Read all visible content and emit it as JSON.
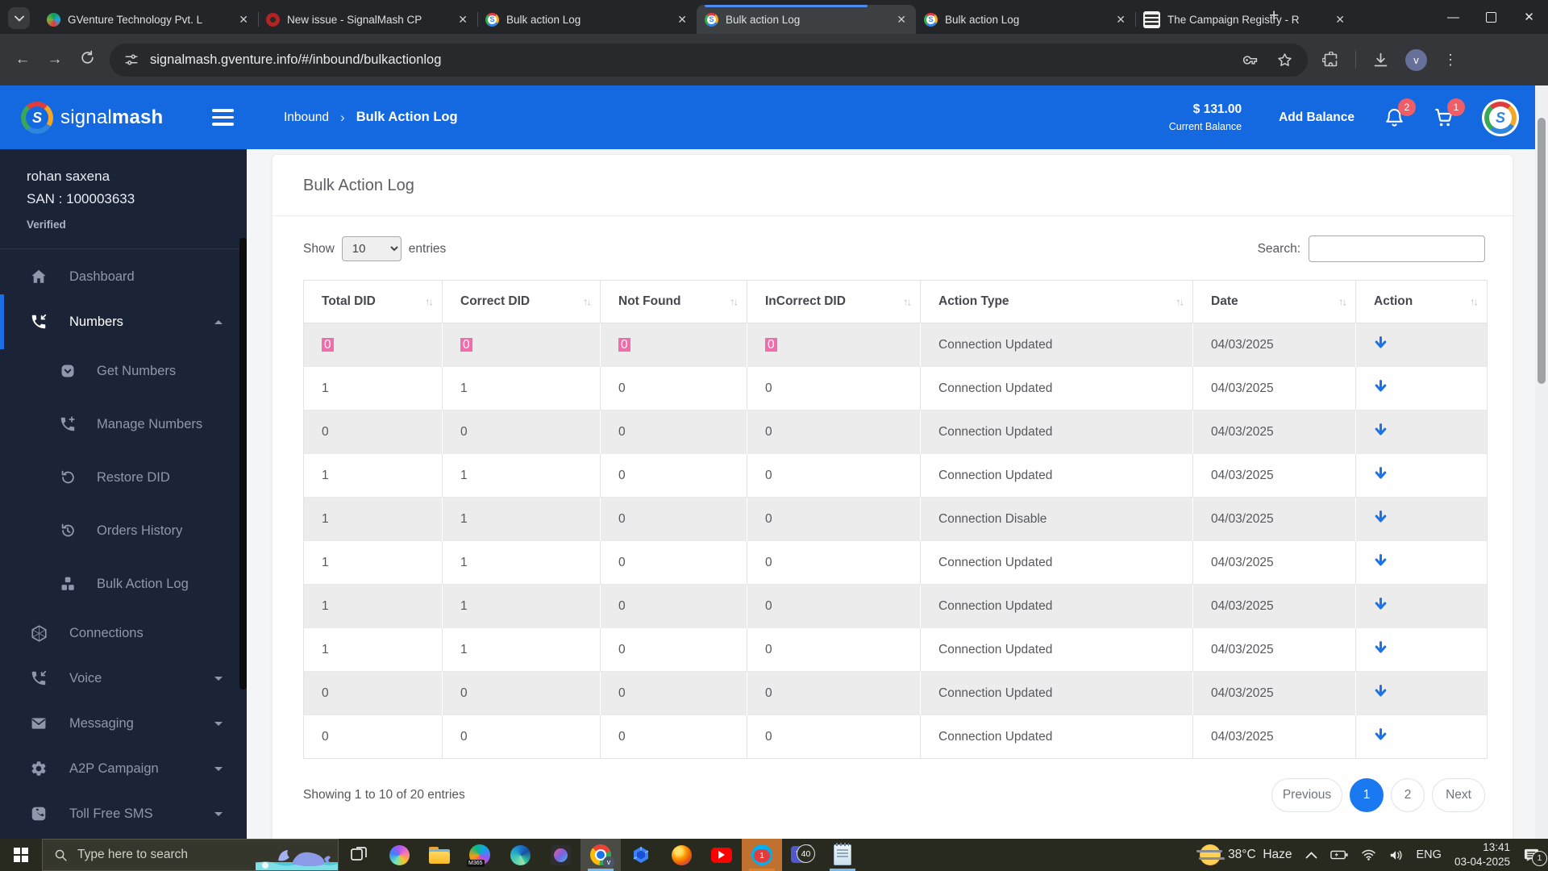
{
  "browser": {
    "tabs": [
      {
        "title": "GVenture Technology Pvt. L",
        "favicon": "gventure",
        "active": false
      },
      {
        "title": "New issue - SignalMash CP",
        "favicon": "redmine",
        "active": false
      },
      {
        "title": "Bulk action Log",
        "favicon": "signalmash",
        "active": false
      },
      {
        "title": "Bulk action Log",
        "favicon": "signalmash",
        "active": true
      },
      {
        "title": "Bulk action Log",
        "favicon": "signalmash",
        "active": false
      },
      {
        "title": "The Campaign Registry - R",
        "favicon": "tcr",
        "active": false
      }
    ],
    "url": "signalmash.gventure.info/#/inbound/bulkactionlog",
    "profile_initial": "v"
  },
  "header": {
    "brand_light": "signal",
    "brand_bold": "mash",
    "breadcrumb_parent": "Inbound",
    "breadcrumb_current": "Bulk Action Log",
    "balance_amount": "$ 131.00",
    "balance_label": "Current Balance",
    "add_balance_label": "Add Balance",
    "bell_badge": "2",
    "cart_badge": "1"
  },
  "sidebar": {
    "user_name": "rohan saxena",
    "user_san": "SAN : 100003633",
    "user_status": "Verified",
    "items": [
      {
        "label": "Dashboard",
        "icon": "home",
        "sub": false,
        "active": false,
        "caret": ""
      },
      {
        "label": "Numbers",
        "icon": "phone-incoming",
        "sub": false,
        "active": true,
        "caret": "up"
      },
      {
        "label": "Get Numbers",
        "icon": "chevron-circle",
        "sub": true,
        "active": false,
        "caret": ""
      },
      {
        "label": "Manage Numbers",
        "icon": "phone-plus",
        "sub": true,
        "active": false,
        "caret": ""
      },
      {
        "label": "Restore DID",
        "icon": "restore",
        "sub": true,
        "active": false,
        "caret": ""
      },
      {
        "label": "Orders History",
        "icon": "history",
        "sub": true,
        "active": false,
        "caret": ""
      },
      {
        "label": "Bulk Action Log",
        "icon": "cubes",
        "sub": true,
        "active": false,
        "caret": ""
      },
      {
        "label": "Connections",
        "icon": "hexagon",
        "sub": false,
        "active": false,
        "caret": ""
      },
      {
        "label": "Voice",
        "icon": "phone-incoming",
        "sub": false,
        "active": false,
        "caret": "down"
      },
      {
        "label": "Messaging",
        "icon": "envelope",
        "sub": false,
        "active": false,
        "caret": "down"
      },
      {
        "label": "A2P Campaign",
        "icon": "gear",
        "sub": false,
        "active": false,
        "caret": "down"
      },
      {
        "label": "Toll Free SMS",
        "icon": "phone-square",
        "sub": false,
        "active": false,
        "caret": "down"
      }
    ]
  },
  "main": {
    "title": "Bulk Action Log",
    "show_label": "Show",
    "page_size": "10",
    "entries_label": "entries",
    "search_label": "Search:",
    "table": {
      "columns": [
        "Total DID",
        "Correct DID",
        "Not Found",
        "InCorrect DID",
        "Action Type",
        "Date",
        "Action"
      ],
      "rows": [
        {
          "total": "0",
          "correct": "0",
          "not_found": "0",
          "incorrect": "0",
          "action_type": "Connection Updated",
          "date": "04/03/2025",
          "highlighted": true
        },
        {
          "total": "1",
          "correct": "1",
          "not_found": "0",
          "incorrect": "0",
          "action_type": "Connection Updated",
          "date": "04/03/2025",
          "highlighted": false
        },
        {
          "total": "0",
          "correct": "0",
          "not_found": "0",
          "incorrect": "0",
          "action_type": "Connection Updated",
          "date": "04/03/2025",
          "highlighted": false
        },
        {
          "total": "1",
          "correct": "1",
          "not_found": "0",
          "incorrect": "0",
          "action_type": "Connection Updated",
          "date": "04/03/2025",
          "highlighted": false
        },
        {
          "total": "1",
          "correct": "1",
          "not_found": "0",
          "incorrect": "0",
          "action_type": "Connection Disable",
          "date": "04/03/2025",
          "highlighted": false
        },
        {
          "total": "1",
          "correct": "1",
          "not_found": "0",
          "incorrect": "0",
          "action_type": "Connection Updated",
          "date": "04/03/2025",
          "highlighted": false
        },
        {
          "total": "1",
          "correct": "1",
          "not_found": "0",
          "incorrect": "0",
          "action_type": "Connection Updated",
          "date": "04/03/2025",
          "highlighted": false
        },
        {
          "total": "1",
          "correct": "1",
          "not_found": "0",
          "incorrect": "0",
          "action_type": "Connection Updated",
          "date": "04/03/2025",
          "highlighted": false
        },
        {
          "total": "0",
          "correct": "0",
          "not_found": "0",
          "incorrect": "0",
          "action_type": "Connection Updated",
          "date": "04/03/2025",
          "highlighted": false
        },
        {
          "total": "0",
          "correct": "0",
          "not_found": "0",
          "incorrect": "0",
          "action_type": "Connection Updated",
          "date": "04/03/2025",
          "highlighted": false
        }
      ]
    },
    "footer": {
      "summary": "Showing 1 to 10 of 20 entries",
      "previous_label": "Previous",
      "pages": [
        "1",
        "2"
      ],
      "active_page": "1",
      "next_label": "Next"
    }
  },
  "taskbar": {
    "search_placeholder": "Type here to search",
    "weather_temp": "38°C",
    "weather_desc": "Haze",
    "language": "ENG",
    "time": "13:41",
    "date": "03-04-2025",
    "skype_badge": "1",
    "teams_badge": "40",
    "notification_badge": "1",
    "m365_label": "M365"
  },
  "colors": {
    "header_blue": "#1569e0",
    "sidebar_navy": "#1b2336",
    "accent_blue": "#1a78f0",
    "selection_pink": "#f06daa",
    "badge_red": "#ef5e67"
  }
}
